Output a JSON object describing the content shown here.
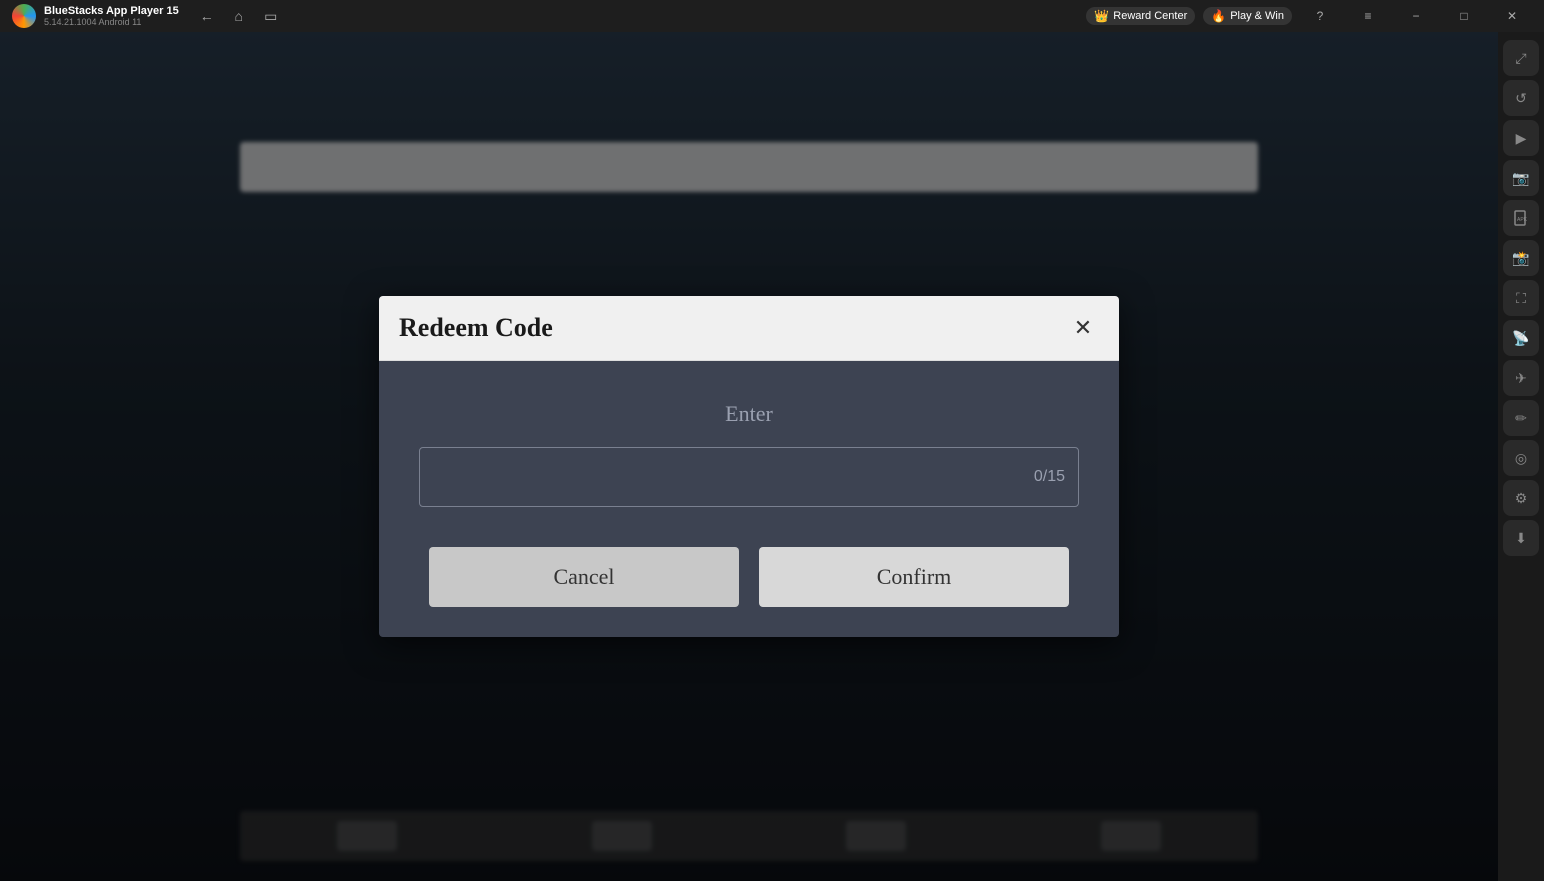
{
  "titlebar": {
    "app_name": "BlueStacks App Player 15",
    "app_version": "5.14.21.1004  Android 11",
    "reward_center_label": "Reward Center",
    "play_win_label": "Play & Win",
    "minimize_label": "−",
    "maximize_label": "□",
    "close_label": "✕",
    "restore_label": "❐",
    "expand_label": "⛶",
    "help_label": "?",
    "menu_label": "≡"
  },
  "sidebar": {
    "icons": [
      {
        "name": "expand-icon",
        "symbol": "⤢"
      },
      {
        "name": "refresh-icon",
        "symbol": "↺"
      },
      {
        "name": "play-icon",
        "symbol": "▶"
      },
      {
        "name": "camera-icon",
        "symbol": "📷"
      },
      {
        "name": "settings-icon",
        "symbol": "⚙"
      },
      {
        "name": "gamepad-icon",
        "symbol": "🎮"
      },
      {
        "name": "keyboard-icon",
        "symbol": "⌨"
      },
      {
        "name": "record-icon",
        "symbol": "⏺"
      },
      {
        "name": "screenshot-icon",
        "symbol": "🖼"
      },
      {
        "name": "rotate-icon",
        "symbol": "🔄"
      },
      {
        "name": "edit-icon",
        "symbol": "✏"
      },
      {
        "name": "macro-icon",
        "symbol": "◎"
      },
      {
        "name": "gear2-icon",
        "symbol": "⚙"
      },
      {
        "name": "download-icon",
        "symbol": "⬇"
      }
    ]
  },
  "dialog": {
    "title": "Redeem Code",
    "close_label": "✕",
    "enter_label": "Enter",
    "input_placeholder": "",
    "input_counter": "0/15",
    "cancel_label": "Cancel",
    "confirm_label": "Confirm"
  }
}
